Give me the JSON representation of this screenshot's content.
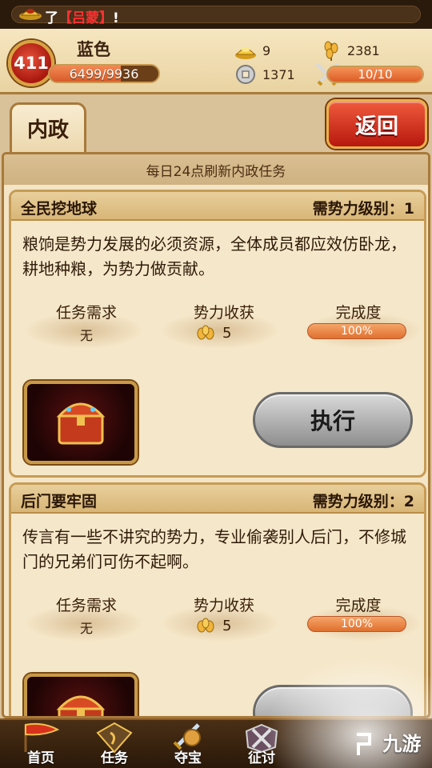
{
  "notice": {
    "prefix": "了",
    "name": "【吕蒙】",
    "suffix": "!"
  },
  "player": {
    "level": "411",
    "name": "蓝色",
    "exp_text": "6499/9936",
    "exp_fraction": 0.654,
    "gold": "9",
    "silver": "1371",
    "grain": "2381",
    "stamina_text": "10/10",
    "stamina_fraction": 1.0
  },
  "tab": {
    "label": "内政"
  },
  "back_button": {
    "label": "返回"
  },
  "refresh_notice": "每日24点刷新内政任务",
  "tasks": [
    {
      "title": "全民挖地球",
      "requirement": "需势力级别：1",
      "description": "粮饷是势力发展的必须资源，全体成员都应效仿卧龙，耕地种粮，为势力做贡献。",
      "col_req_label": "任务需求",
      "col_req_value": "无",
      "col_reward_label": "势力收获",
      "col_reward_value": "5",
      "col_progress_label": "完成度",
      "col_progress_value": "100%",
      "exec_label": "执行"
    },
    {
      "title": "后门要牢固",
      "requirement": "需势力级别：2",
      "description": "传言有一些不讲究的势力，专业偷袭别人后门，不修城门的兄弟们可伤不起啊。",
      "col_req_label": "任务需求",
      "col_req_value": "无",
      "col_reward_label": "势力收获",
      "col_reward_value": "5",
      "col_progress_label": "完成度",
      "col_progress_value": "100%"
    }
  ],
  "nav": [
    {
      "label": "首页",
      "icon": "flag-icon"
    },
    {
      "label": "任务",
      "icon": "scroll-icon"
    },
    {
      "label": "夺宝",
      "icon": "sword-icon"
    },
    {
      "label": "征讨",
      "icon": "crossed-swords-icon"
    }
  ],
  "watermark": "九游",
  "colors": {
    "accent_red": "#b8180e",
    "panel_bg": "#f3e5c6",
    "frame_gold": "#c89a48",
    "progress_orange": "#e0702e"
  }
}
